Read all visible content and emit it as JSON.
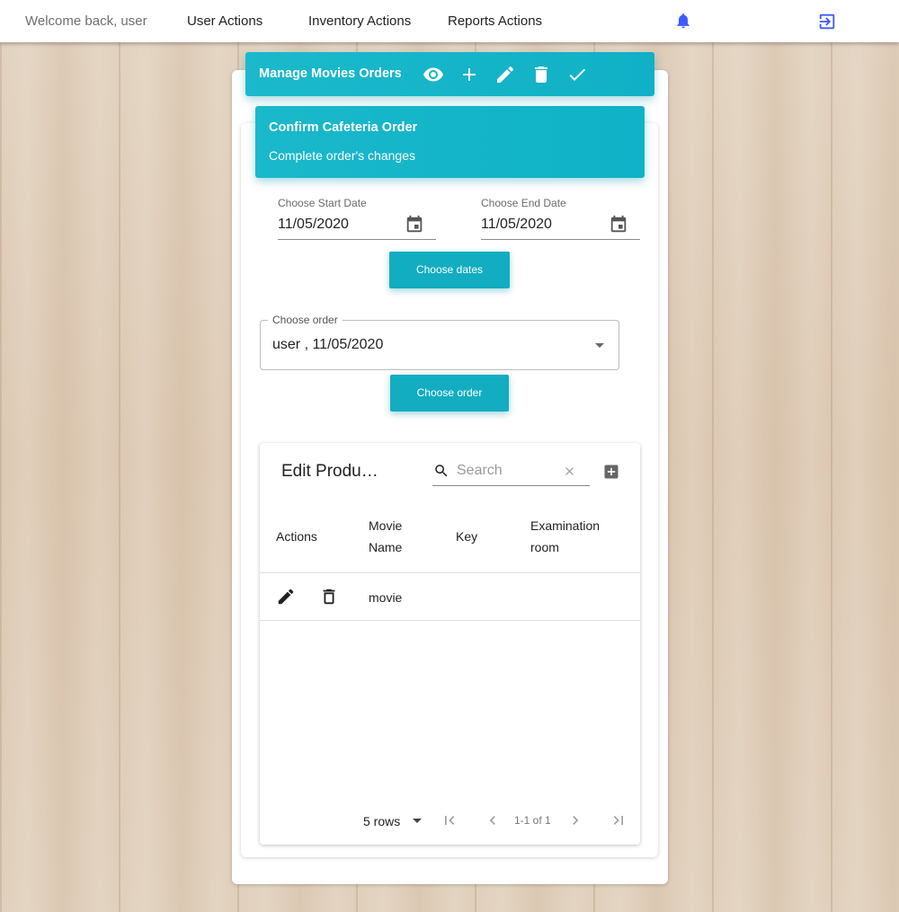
{
  "topbar": {
    "welcome": "Welcome back, user",
    "nav": [
      "User Actions",
      "Inventory Actions",
      "Reports Actions"
    ],
    "icons": [
      "bell-icon",
      "exit-icon"
    ],
    "bell_color": "#3d5afe"
  },
  "header": {
    "title": "Manage Movies Orders",
    "icons": [
      "eye-icon",
      "plus-icon",
      "pencil-icon",
      "trash-icon",
      "check-icon"
    ],
    "color": "#12b2c7"
  },
  "confirm": {
    "title": "Confirm Cafeteria Order",
    "subtitle": "Complete order's changes"
  },
  "dates": {
    "start_label": "Choose Start Date",
    "start_value": "11/05/2020",
    "end_label": "Choose End Date",
    "end_value": "11/05/2020",
    "button": "Choose dates"
  },
  "order": {
    "label": "Choose order",
    "value": "user , 11/05/2020",
    "button": "Choose order"
  },
  "table": {
    "title": "Edit Produ…",
    "search_placeholder": "Search",
    "columns": [
      "Actions",
      "Movie Name",
      "Key",
      "Examination room"
    ],
    "col_movie_1": "Movie",
    "col_movie_2": "Name",
    "col_exam_1": "Examination",
    "col_exam_2": "room",
    "rows": [
      {
        "movie": "movie",
        "key": "",
        "room": ""
      }
    ],
    "pagination": {
      "rows_per_page": "5 rows",
      "range": "1-1 of 1"
    }
  }
}
